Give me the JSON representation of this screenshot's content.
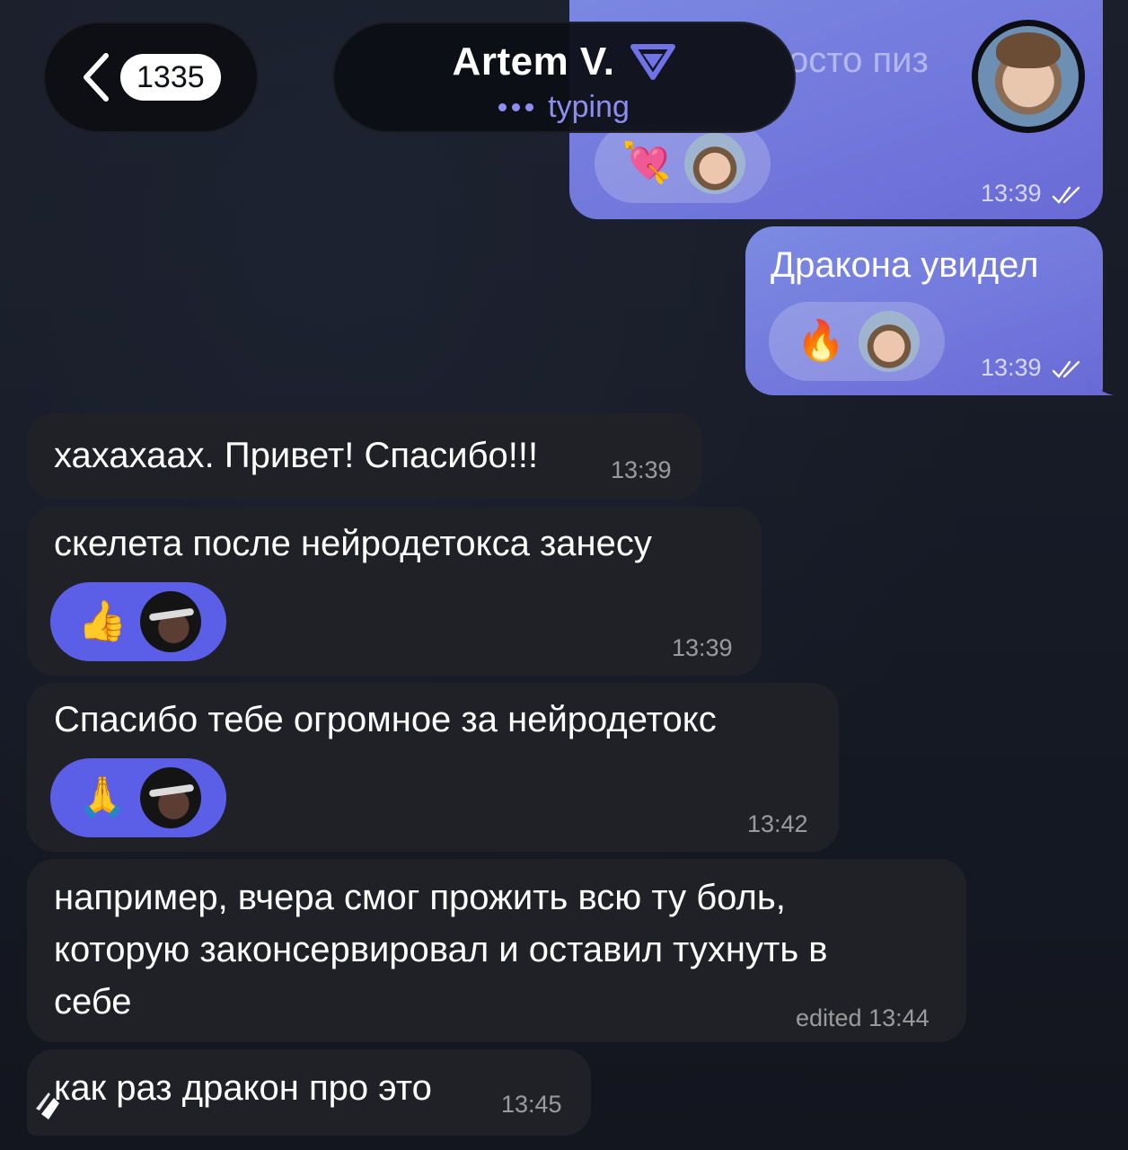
{
  "header": {
    "back_badge": "1335",
    "contact_name": "Artem V.",
    "status": "typing",
    "accent_color": "#8c8ff0"
  },
  "partial_message_text": "осто пиз",
  "messages_out": [
    {
      "text": "",
      "reaction_emoji": "💘",
      "time": "13:39"
    },
    {
      "text": "Дракона увидел",
      "reaction_emoji": "🔥",
      "time": "13:39"
    }
  ],
  "messages_in": [
    {
      "text": "хахахаах. Привет! Спасибо!!!",
      "time": "13:39"
    },
    {
      "text": "скелета после нейродетокса занесу",
      "reaction_emoji": "👍",
      "time": "13:39"
    },
    {
      "text": "Спасибо тебе огромное за нейродетокс",
      "reaction_emoji": "🙏",
      "time": "13:42"
    },
    {
      "text_lines": [
        "например, вчера смог прожить всю ту боль,",
        "которую законсервировал и оставил тухнуть в",
        "себе"
      ],
      "time": "edited 13:44"
    },
    {
      "text": "как раз дракон про это",
      "time": "13:45"
    }
  ],
  "icons": [
    "back-chevron-icon",
    "verified-icon",
    "double-check-icon",
    "scroll-handle-icon"
  ]
}
